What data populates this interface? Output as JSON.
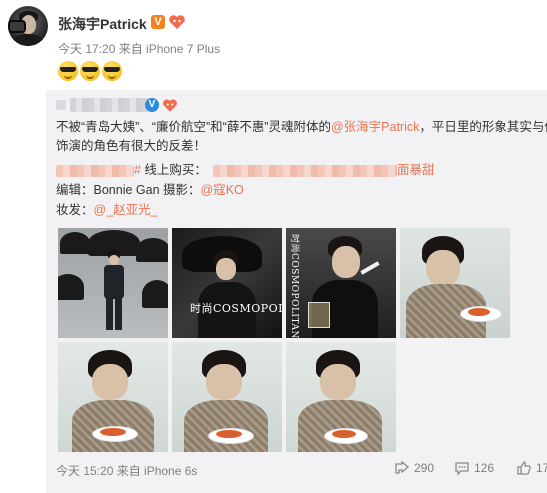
{
  "post": {
    "author": "张海宇Patrick",
    "v_badge": "V",
    "meta": "今天 17:20 来自 iPhone 7 Plus",
    "emoji_icons": [
      "sunglasses-smile-icon",
      "sunglasses-smile-icon",
      "sunglasses-smile-icon"
    ]
  },
  "repost": {
    "author_blurred": true,
    "text": {
      "line1_prefix": "不被“青岛大姨”、“廉价航空”和“薛不惠”灵魂附体的",
      "line1_mention": "@张海宇Patrick",
      "line1_suffix": "，平日里的形象其实与他所",
      "line2": "饰演的角色有很大的反差！",
      "line3_hash_tail": "#",
      "line3_text": " 线上购买：",
      "line3_link_tail": "面暴甜",
      "line4_label": "编辑：Bonnie Gan 摄影：",
      "line4_mention": "@寇KO",
      "line5_label": "妆发：",
      "line5_mention": "@_赵亚光_"
    },
    "photos": [
      {
        "id": 1,
        "subject": "man-with-umbrella"
      },
      {
        "id": 2,
        "subject": "cosmopolitan-cover-dark",
        "mag_text": "时尚COSMOPOLITAN"
      },
      {
        "id": 3,
        "subject": "cosmopolitan-cover-portrait",
        "mag_text": "时尚COSMOPOLITAN"
      },
      {
        "id": 4,
        "subject": "eating-pasta"
      },
      {
        "id": 5,
        "subject": "eating-pasta"
      },
      {
        "id": 6,
        "subject": "eating-pasta"
      },
      {
        "id": 7,
        "subject": "eating-pasta"
      }
    ],
    "meta": "今天 15:20 来自 iPhone 6s",
    "actions": {
      "repost_count": "290",
      "comment_count": "126",
      "like_count": "17"
    }
  },
  "colors": {
    "link": "#eb7350",
    "meta_text": "#808080",
    "repost_bg": "#f2f2f5",
    "v_badge": "#f58220"
  }
}
